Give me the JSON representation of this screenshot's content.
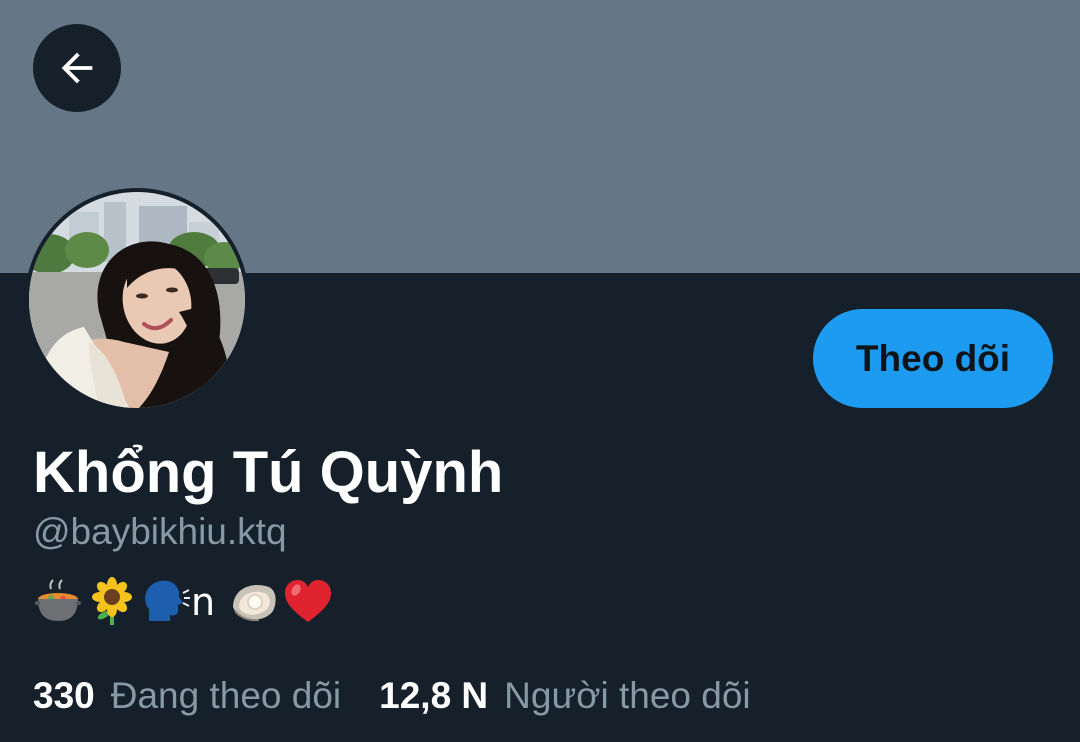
{
  "header": {
    "banner_color": "#657786",
    "back_icon": "arrow-left-icon"
  },
  "profile": {
    "display_name": "Khổng Tú Quỳnh",
    "handle": "@baybikhiu.ktq",
    "bio_emojis": [
      "stew-pot-emoji",
      "sunflower-emoji",
      "speaking-head-emoji",
      "oyster-emoji",
      "red-heart-emoji"
    ],
    "bio_text": "n",
    "avatar": "profile-photo"
  },
  "actions": {
    "follow_label": "Theo dõi",
    "accent_color": "#1d9bf0"
  },
  "stats": {
    "following_count": "330",
    "following_label": "Đang theo dõi",
    "followers_count": "12,8 N",
    "followers_label": "Người theo dõi"
  }
}
